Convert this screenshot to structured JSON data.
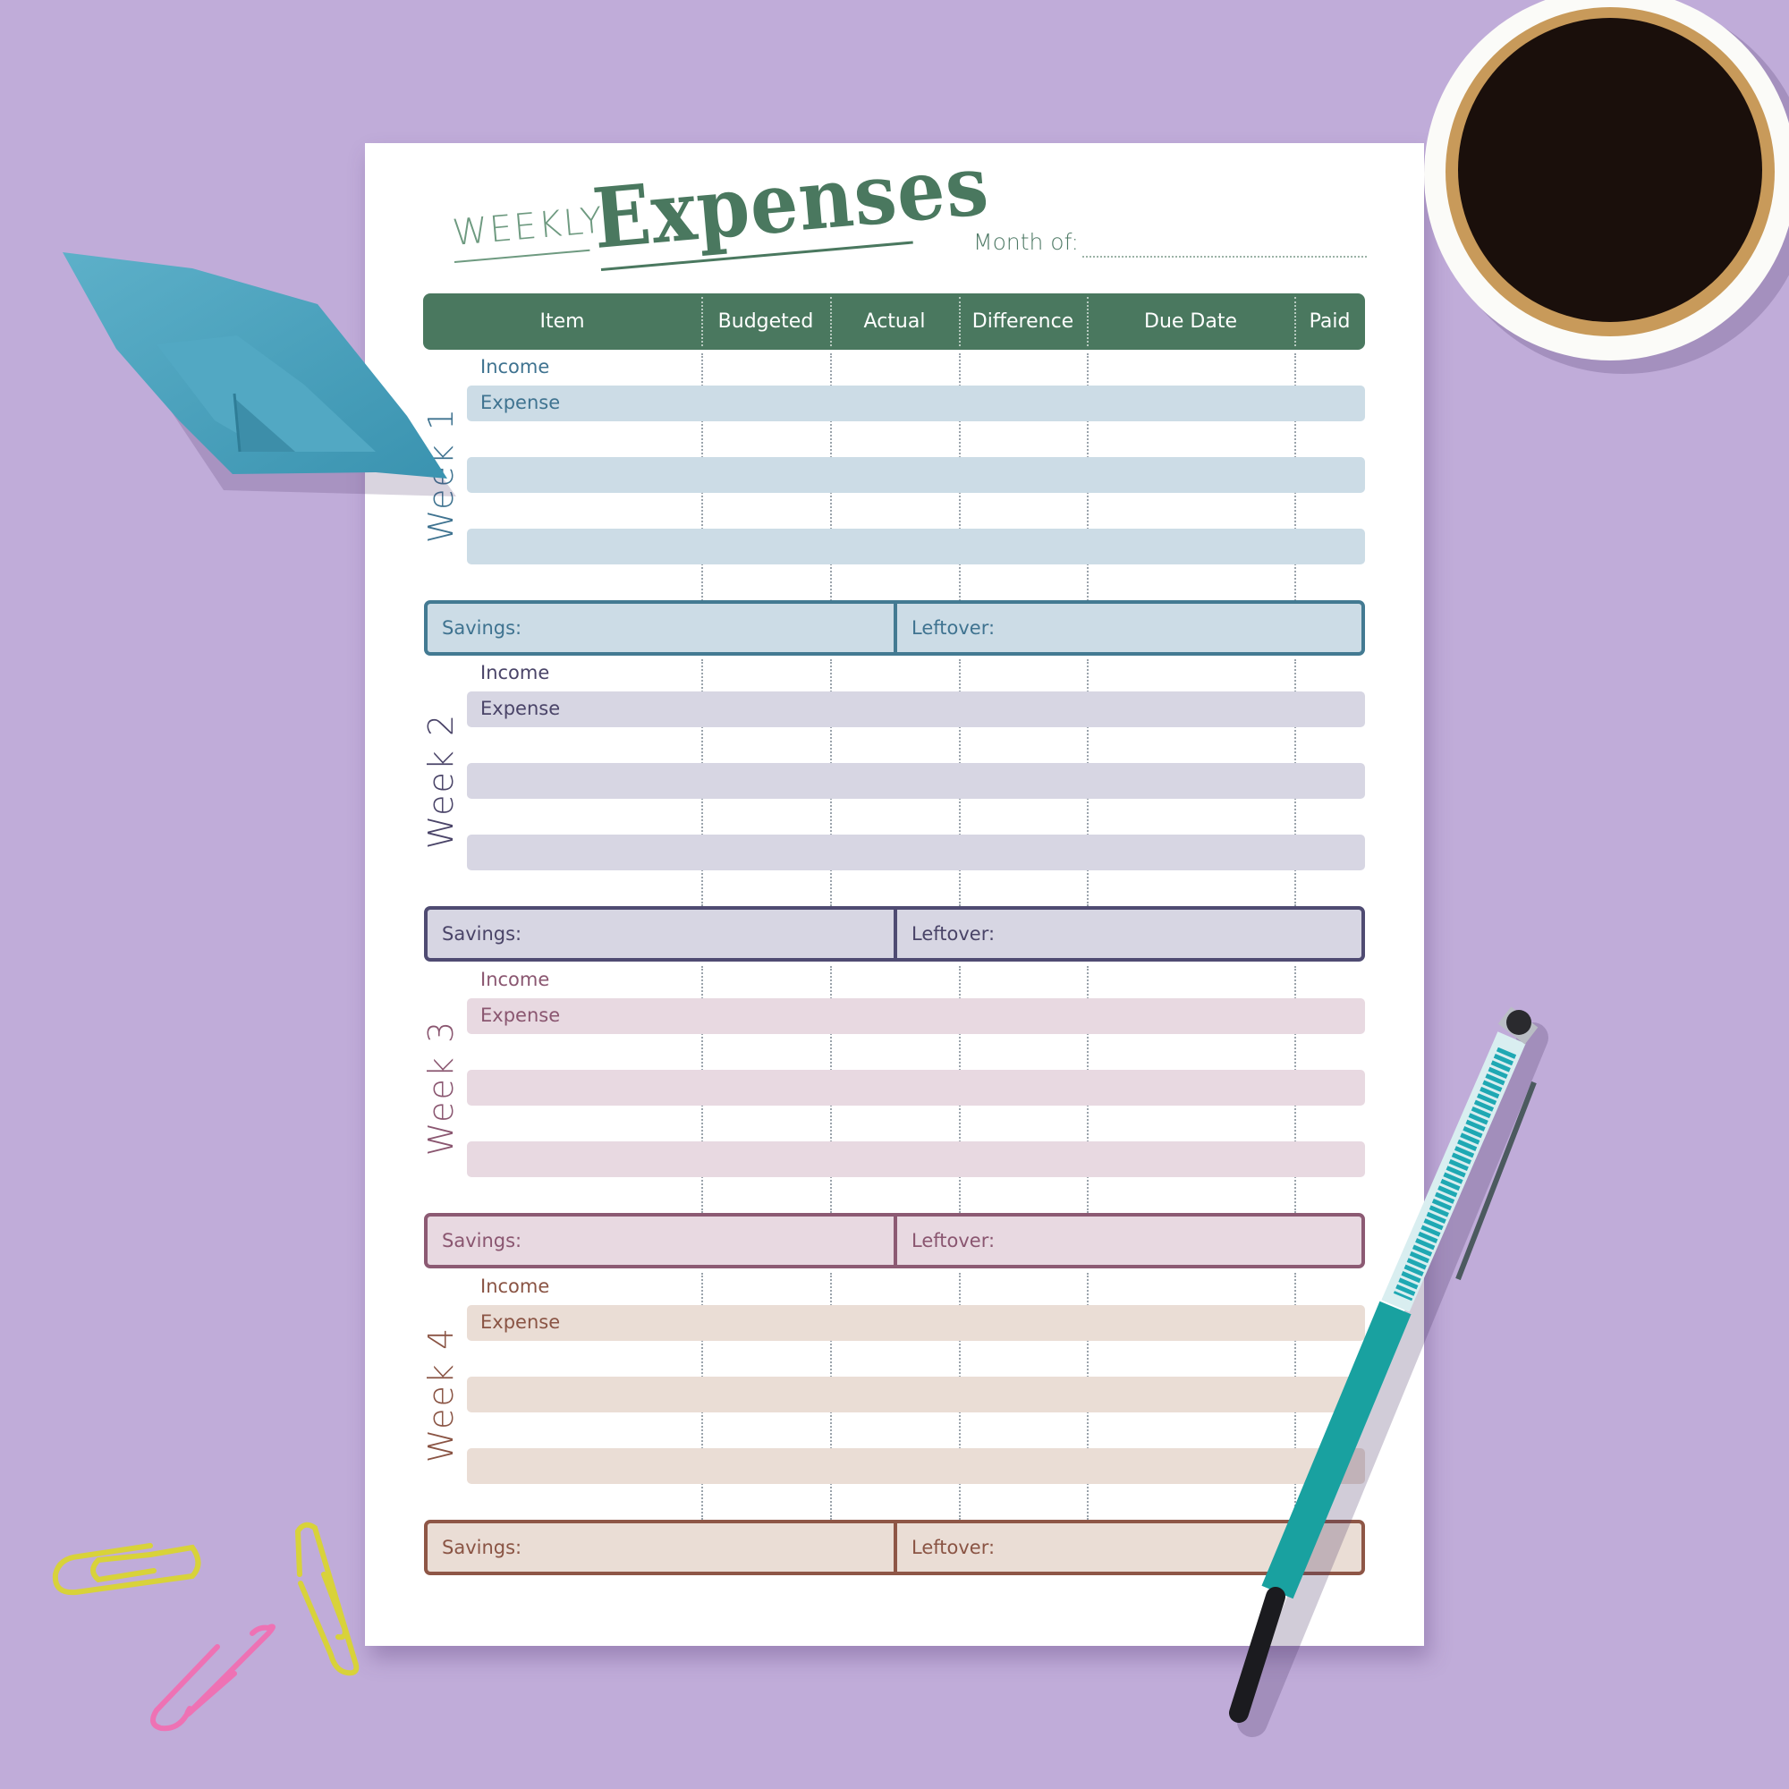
{
  "title": {
    "weekly": "WEEKLY",
    "expenses": "Expenses",
    "month_label": "Month of:",
    "month_value": ""
  },
  "columns": [
    "Item",
    "Budgeted",
    "Actual",
    "Difference",
    "Due Date",
    "Paid"
  ],
  "weeks": [
    {
      "label": "Week 1",
      "income_label": "Income",
      "expense_label": "Expense",
      "savings_label": "Savings:",
      "leftover_label": "Leftover:",
      "colors": {
        "text": "#3f7390",
        "band": "#ccdce6",
        "border": "#437a92"
      }
    },
    {
      "label": "Week 2",
      "income_label": "Income",
      "expense_label": "Expense",
      "savings_label": "Savings:",
      "leftover_label": "Leftover:",
      "colors": {
        "text": "#4a4468",
        "band": "#d7d6e3",
        "border": "#4f4b72"
      }
    },
    {
      "label": "Week 3",
      "income_label": "Income",
      "expense_label": "Expense",
      "savings_label": "Savings:",
      "leftover_label": "Leftover:",
      "colors": {
        "text": "#8a5670",
        "band": "#e8d9e1",
        "border": "#8c5a73"
      }
    },
    {
      "label": "Week 4",
      "income_label": "Income",
      "expense_label": "Expense",
      "savings_label": "Savings:",
      "leftover_label": "Leftover:",
      "colors": {
        "text": "#8a5444",
        "band": "#eaddd5",
        "border": "#8e5646"
      }
    }
  ],
  "colors": {
    "background": "#c0acd9",
    "header": "#4a785f",
    "paper": "#ffffff"
  }
}
